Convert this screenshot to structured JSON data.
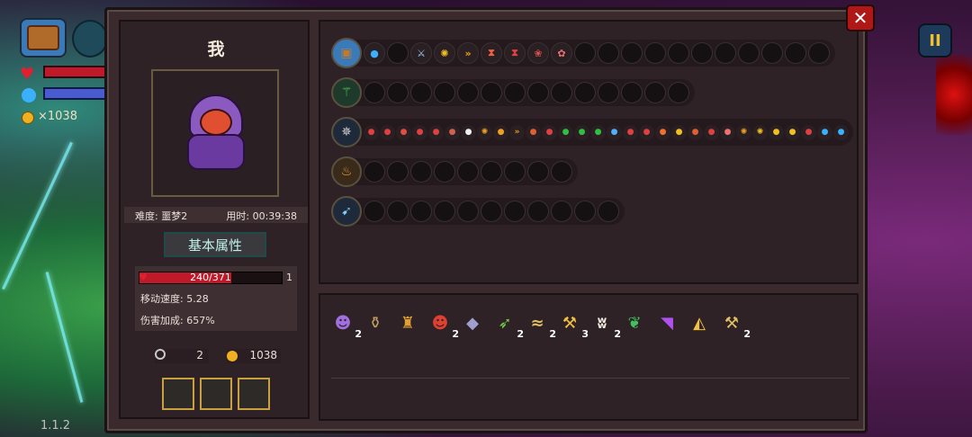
{
  "hud": {
    "coins": "×1038",
    "version": "1.1.2",
    "pause_label": "II"
  },
  "panel": {
    "close_label": "✕",
    "player_name": "我",
    "difficulty": "难度: 噩梦2",
    "time": "用时: 00:39:38",
    "base_attr_label": "基本属性",
    "hp_text": "240/371",
    "hp_fraction": 0.647,
    "hp_extra": "1",
    "move_speed": "移动速度: 5.28",
    "damage_bonus": "伤害加成: 657%",
    "keys": "2",
    "coins": "1038"
  },
  "weapons": [
    {
      "icon": "treasure-chest-icon",
      "slots": [
        {
          "glyph": "●",
          "color": "#3ab0ff"
        },
        {
          "glyph": "",
          "color": ""
        },
        {
          "glyph": "⚔",
          "color": "#9ad0ff"
        },
        {
          "glyph": "✺",
          "color": "#f0c020"
        },
        {
          "glyph": "»",
          "color": "#f0a020"
        },
        {
          "glyph": "⧗",
          "color": "#f06040"
        },
        {
          "glyph": "⧗",
          "color": "#e04040"
        },
        {
          "glyph": "❀",
          "color": "#e05050"
        },
        {
          "glyph": "✿",
          "color": "#f07070"
        }
      ],
      "empty": 11
    },
    {
      "icon": "green-staff-icon",
      "slots": [],
      "empty": 14
    },
    {
      "icon": "spiked-mace-icon",
      "slots": [
        {
          "glyph": "●",
          "color": "#e04040"
        },
        {
          "glyph": "●",
          "color": "#e04040"
        },
        {
          "glyph": "●",
          "color": "#e05040"
        },
        {
          "glyph": "●",
          "color": "#e04040"
        },
        {
          "glyph": "●",
          "color": "#e04040"
        },
        {
          "glyph": "●",
          "color": "#d06050"
        },
        {
          "glyph": "●",
          "color": "#f0f0f0"
        },
        {
          "glyph": "✺",
          "color": "#f0a020"
        },
        {
          "glyph": "●",
          "color": "#f0a020"
        },
        {
          "glyph": "»",
          "color": "#f0a020"
        },
        {
          "glyph": "●",
          "color": "#e06030"
        },
        {
          "glyph": "●",
          "color": "#e04040"
        },
        {
          "glyph": "●",
          "color": "#30c040"
        },
        {
          "glyph": "●",
          "color": "#30c040"
        },
        {
          "glyph": "●",
          "color": "#30c040"
        },
        {
          "glyph": "●",
          "color": "#50b0ff"
        },
        {
          "glyph": "●",
          "color": "#e04040"
        },
        {
          "glyph": "●",
          "color": "#e04040"
        },
        {
          "glyph": "●",
          "color": "#f07030"
        },
        {
          "glyph": "●",
          "color": "#f0c020"
        },
        {
          "glyph": "●",
          "color": "#e06030"
        },
        {
          "glyph": "●",
          "color": "#e04040"
        },
        {
          "glyph": "●",
          "color": "#f07070"
        },
        {
          "glyph": "✺",
          "color": "#f0a020"
        },
        {
          "glyph": "✺",
          "color": "#f0c020"
        },
        {
          "glyph": "●",
          "color": "#f0c020"
        },
        {
          "glyph": "●",
          "color": "#f0c020"
        },
        {
          "glyph": "●",
          "color": "#e04040"
        },
        {
          "glyph": "●",
          "color": "#3ab0ff"
        },
        {
          "glyph": "●",
          "color": "#3ab0ff"
        }
      ],
      "empty": 0,
      "small": true
    },
    {
      "icon": "torch-icon",
      "slots": [],
      "empty": 9
    },
    {
      "icon": "ice-spear-icon",
      "slots": [],
      "empty": 11
    }
  ],
  "items": [
    {
      "name": "purple-hair-item-icon",
      "glyph": "☻",
      "color": "#a070e0",
      "count": "2"
    },
    {
      "name": "bottle-item-icon",
      "glyph": "⚱",
      "color": "#c0a060",
      "count": ""
    },
    {
      "name": "chalice-item-icon",
      "glyph": "♜",
      "color": "#e0a030",
      "count": ""
    },
    {
      "name": "red-mask-item-icon",
      "glyph": "☻",
      "color": "#e04030",
      "count": "2"
    },
    {
      "name": "crystal-item-icon",
      "glyph": "◆",
      "color": "#a0a0d0",
      "count": ""
    },
    {
      "name": "green-dart-item-icon",
      "glyph": "➶",
      "color": "#70d050",
      "count": "2"
    },
    {
      "name": "bone-item-icon",
      "glyph": "≈",
      "color": "#e0c060",
      "count": "2"
    },
    {
      "name": "pickaxe-item-icon",
      "glyph": "⚒",
      "color": "#f0c040",
      "count": "3"
    },
    {
      "name": "jaw-trap-item-icon",
      "glyph": "ʬ",
      "color": "#f0f0e0",
      "count": "2"
    },
    {
      "name": "leaf-item-icon",
      "glyph": "❦",
      "color": "#40c060",
      "count": ""
    },
    {
      "name": "shield-item-icon",
      "glyph": "◥",
      "color": "#b050f0",
      "count": ""
    },
    {
      "name": "potion-item-icon",
      "glyph": "◭",
      "color": "#f0c040",
      "count": ""
    },
    {
      "name": "hammer-item-icon",
      "glyph": "⚒",
      "color": "#e0c060",
      "count": "2"
    }
  ]
}
